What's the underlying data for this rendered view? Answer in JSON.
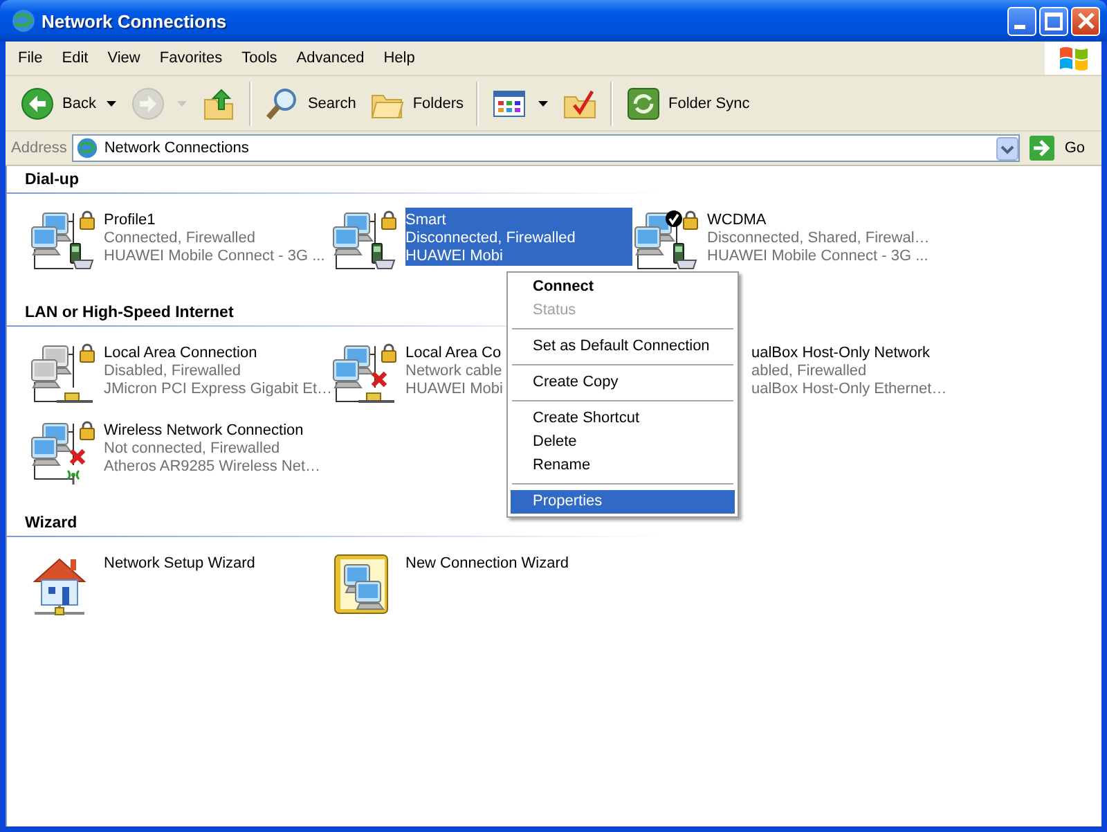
{
  "window": {
    "title": "Network Connections"
  },
  "menu_bar": [
    {
      "label": "File"
    },
    {
      "label": "Edit"
    },
    {
      "label": "View"
    },
    {
      "label": "Favorites"
    },
    {
      "label": "Tools"
    },
    {
      "label": "Advanced"
    },
    {
      "label": "Help"
    }
  ],
  "toolbar": [
    {
      "kind": "back",
      "label": "Back",
      "dropdown": true,
      "disabled": false
    },
    {
      "kind": "forward",
      "dropdown": true,
      "disabled": true
    },
    {
      "kind": "up",
      "dropdown": false,
      "disabled": false
    },
    {
      "kind": "separator"
    },
    {
      "kind": "search",
      "label": "Search",
      "dropdown": false,
      "disabled": false
    },
    {
      "kind": "folders",
      "label": "Folders",
      "dropdown": false,
      "disabled": false
    },
    {
      "kind": "separator"
    },
    {
      "kind": "views",
      "dropdown": true,
      "disabled": false
    },
    {
      "kind": "checkfolder",
      "dropdown": false,
      "disabled": false
    },
    {
      "kind": "separator"
    },
    {
      "kind": "sync",
      "label": "Folder Sync",
      "dropdown": false,
      "disabled": false
    }
  ],
  "address_bar": {
    "label": "Address",
    "value": "Network Connections",
    "go": "Go"
  },
  "groups": [
    {
      "title": "Dial-up",
      "items": [
        {
          "kind": "dialup",
          "name": "Profile1",
          "lines": [
            "Connected, Firewalled",
            "HUAWEI Mobile Connect - 3G ..."
          ],
          "selected": false,
          "firewalled": true,
          "error": false,
          "default": false,
          "covered": false
        },
        {
          "kind": "dialup",
          "name": "Smart",
          "lines": [
            "Disconnected, Firewalled",
            "HUAWEI Mobi"
          ],
          "selected": true,
          "firewalled": true,
          "error": false,
          "default": false,
          "covered": false
        },
        {
          "kind": "dialup",
          "name": "WCDMA",
          "lines": [
            "Disconnected, Shared, Firewal…",
            "HUAWEI Mobile Connect - 3G ..."
          ],
          "selected": false,
          "firewalled": true,
          "error": false,
          "default": true,
          "covered": false
        }
      ]
    },
    {
      "title": "LAN or High-Speed Internet",
      "items": [
        {
          "kind": "lan",
          "name": "Local Area Connection",
          "lines": [
            "Disabled, Firewalled",
            "JMicron PCI Express Gigabit Et…"
          ],
          "selected": false,
          "firewalled": true,
          "error": false,
          "default": false,
          "covered": false,
          "disabled": true
        },
        {
          "kind": "lan",
          "name": "Local Area Co",
          "lines": [
            "Network cable",
            "HUAWEI Mobi"
          ],
          "selected": false,
          "firewalled": true,
          "error": true,
          "default": false,
          "covered": false
        },
        {
          "name": "ualBox Host-Only Network",
          "lines": [
            "abled, Firewalled",
            "ualBox Host-Only Ethernet…"
          ],
          "selected": false,
          "covered": true
        },
        {
          "kind": "wireless",
          "name": "Wireless Network Connection",
          "lines": [
            "Not connected, Firewalled",
            "Atheros AR9285 Wireless Net…"
          ],
          "selected": false,
          "firewalled": true,
          "error": true,
          "default": false,
          "covered": false
        }
      ]
    },
    {
      "title": "Wizard",
      "items": [
        {
          "kind": "home-wizard",
          "name": "Network Setup Wizard",
          "selected": false,
          "covered": false
        },
        {
          "kind": "connection-wizard",
          "name": "New Connection Wizard",
          "selected": false,
          "covered": false
        }
      ]
    }
  ],
  "context_menu": {
    "items": [
      {
        "kind": "item",
        "label": "Connect",
        "default": true,
        "disabled": false,
        "selected": false
      },
      {
        "kind": "item",
        "label": "Status",
        "default": false,
        "disabled": true,
        "selected": false
      },
      {
        "kind": "separator"
      },
      {
        "kind": "item",
        "label": "Set as Default Connection",
        "default": false,
        "disabled": false,
        "selected": false
      },
      {
        "kind": "separator"
      },
      {
        "kind": "item",
        "label": "Create Copy",
        "default": false,
        "disabled": false,
        "selected": false
      },
      {
        "kind": "separator"
      },
      {
        "kind": "item",
        "label": "Create Shortcut",
        "default": false,
        "disabled": false,
        "selected": false
      },
      {
        "kind": "item",
        "label": "Delete",
        "default": false,
        "disabled": false,
        "selected": false
      },
      {
        "kind": "item",
        "label": "Rename",
        "default": false,
        "disabled": false,
        "selected": false
      },
      {
        "kind": "separator"
      },
      {
        "kind": "item",
        "label": "Properties",
        "default": false,
        "disabled": false,
        "selected": true
      }
    ]
  }
}
